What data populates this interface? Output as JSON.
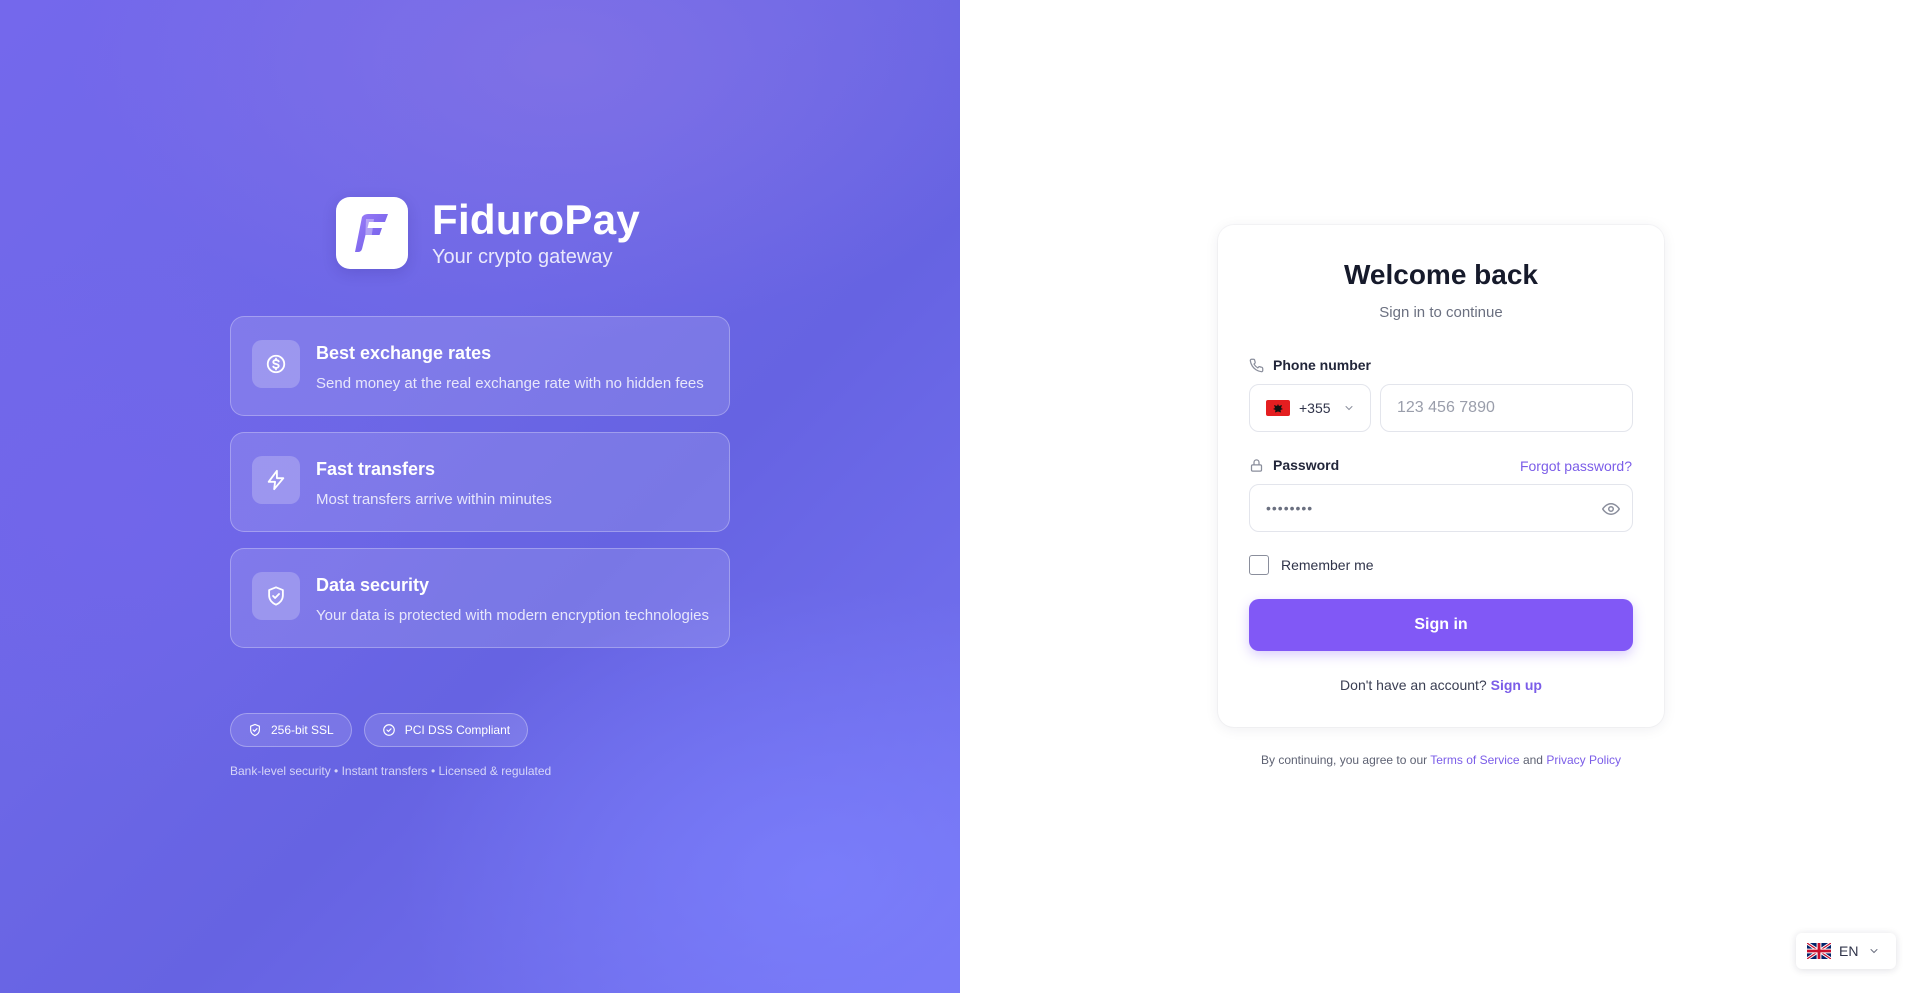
{
  "brand": {
    "name": "FiduroPay",
    "tagline": "Your crypto gateway",
    "logo_icon": "fiduropay-logo-icon"
  },
  "features": [
    {
      "icon": "dollar-circle-icon",
      "title": "Best exchange rates",
      "description": "Send money at the real exchange rate with no hidden fees"
    },
    {
      "icon": "lightning-icon",
      "title": "Fast transfers",
      "description": "Most transfers arrive within minutes"
    },
    {
      "icon": "shield-check-icon",
      "title": "Data security",
      "description": "Your data is protected with modern encryption technologies"
    }
  ],
  "badges": [
    {
      "icon": "shield-icon",
      "label": "256-bit SSL"
    },
    {
      "icon": "check-circle-icon",
      "label": "PCI DSS Compliant"
    }
  ],
  "footline": "Bank-level security • Instant transfers • Licensed & regulated",
  "login": {
    "title": "Welcome back",
    "subtitle": "Sign in to continue",
    "phone_label": "Phone number",
    "country_code": "+355",
    "phone_placeholder": "123 456 7890",
    "password_label": "Password",
    "forgot_label": "Forgot password?",
    "password_value": "••••••••",
    "remember_label": "Remember me",
    "signin_label": "Sign in",
    "no_account_text": "Don't have an account?",
    "signup_label": "Sign up"
  },
  "terms": {
    "prefix": "By continuing, you agree to our",
    "terms_label": "Terms of Service",
    "and": "and",
    "privacy_label": "Privacy Policy"
  },
  "language": {
    "code": "EN"
  },
  "colors": {
    "accent": "#8158f6",
    "link": "#7b5de8",
    "flag_albania": "#e41e20"
  }
}
